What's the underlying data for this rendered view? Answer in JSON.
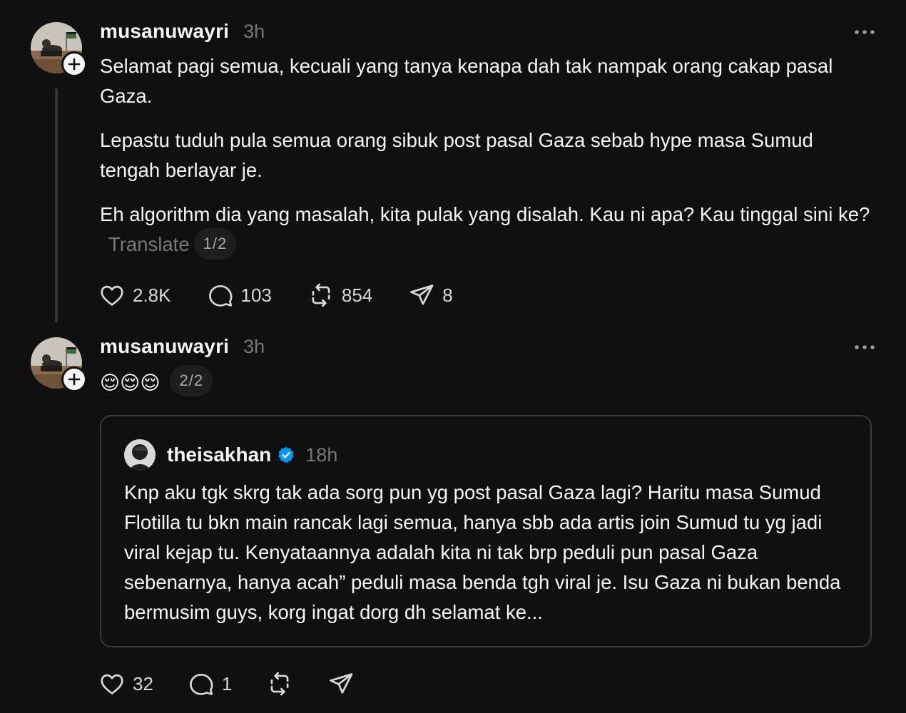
{
  "colors": {
    "background": "#101010",
    "text_primary": "#f3f5f7",
    "text_secondary": "#777777",
    "verified_blue": "#0095f6",
    "border": "#3a3a3a"
  },
  "post1": {
    "username": "musanuwayri",
    "time": "3h",
    "paragraphs": [
      "Selamat pagi semua, kecuali yang tanya kenapa dah tak nampak orang cakap pasal Gaza.",
      "Lepastu tuduh pula semua orang sibuk post pasal Gaza sebab hype masa Sumud tengah berlayar je.",
      "Eh algorithm dia yang masalah, kita pulak yang disalah. Kau ni apa? Kau tinggal sini ke?"
    ],
    "translate_label": "Translate",
    "page_indicator": "1/2",
    "actions": {
      "likes": "2.8K",
      "replies": "103",
      "reposts": "854",
      "shares": "8"
    }
  },
  "post2": {
    "username": "musanuwayri",
    "time": "3h",
    "emojis": [
      "😌",
      "😌",
      "😌"
    ],
    "page_indicator": "2/2",
    "quote": {
      "username": "theisakhan",
      "time": "18h",
      "text": "Knp aku tgk skrg tak ada sorg pun yg post pasal Gaza lagi? Haritu masa Sumud Flotilla tu bkn main rancak lagi semua, hanya sbb ada artis join Sumud tu yg jadi viral kejap tu. Kenyataannya adalah kita ni tak brp peduli pun pasal Gaza sebenarnya, hanya acah” peduli masa benda tgh viral je. Isu Gaza ni bukan benda bermusim guys, korg ingat dorg dh selamat ke..."
    },
    "actions": {
      "likes": "32",
      "replies": "1"
    }
  },
  "icons": {
    "like": "heart-icon",
    "reply": "comment-icon",
    "repost": "repost-icon",
    "share": "send-icon",
    "more": "more-horizontal-icon",
    "follow": "plus-icon",
    "verified": "verified-badge-icon"
  }
}
